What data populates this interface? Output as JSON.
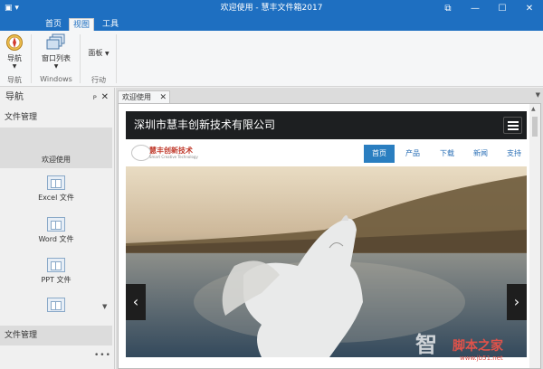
{
  "window": {
    "title": "欢迎使用 - 慧丰文件箱2017",
    "menu_icon": "app-menu-icon",
    "controls": [
      "restore-icon",
      "minimize-icon",
      "maximize-icon",
      "close-icon"
    ]
  },
  "ribbon": {
    "tabs": [
      {
        "label": "首页",
        "active": false
      },
      {
        "label": "视图",
        "active": true
      },
      {
        "label": "工具",
        "active": false
      }
    ],
    "buttons": {
      "nav_label": "导航",
      "window_list_label": "窗口列表",
      "panel_label": "面板"
    },
    "groups": {
      "nav": "导航",
      "windows": "Windows",
      "actions": "行动"
    }
  },
  "nav": {
    "header": "导航",
    "pin_symbol": "ᴘ",
    "close_symbol": "✕",
    "section_title": "文件管理",
    "items": [
      {
        "label": "欢迎使用",
        "icon": "welcome-icon",
        "selected": true
      },
      {
        "label": "Excel 文件",
        "icon": "excel-file-icon",
        "selected": false
      },
      {
        "label": "Word 文件",
        "icon": "word-file-icon",
        "selected": false
      },
      {
        "label": "PPT 文件",
        "icon": "ppt-file-icon",
        "selected": false
      },
      {
        "label": ".......",
        "icon": "more-file-icon",
        "selected": false
      }
    ],
    "bottom_section": "文件管理",
    "more": "•••"
  },
  "document": {
    "tab_label": "欢迎使用",
    "tab_close": "✕"
  },
  "website": {
    "company_name": "深圳市慧丰创新技术有限公司",
    "logo_text": "慧丰创新技术",
    "logo_sub": "Smart Creative Technology",
    "nav_links": [
      {
        "label": "首页",
        "active": true
      },
      {
        "label": "产品",
        "active": false
      },
      {
        "label": "下载",
        "active": false
      },
      {
        "label": "新闻",
        "active": false
      },
      {
        "label": "支持",
        "active": false
      }
    ],
    "banner_prev": "‹",
    "banner_next": "›"
  },
  "watermark": {
    "text": "脚本之家",
    "url": "www.jb51.net"
  },
  "colors": {
    "title_bar": "#1e6fc1",
    "site_header": "#1d1f21",
    "nav_active": "#2a7ec0"
  }
}
